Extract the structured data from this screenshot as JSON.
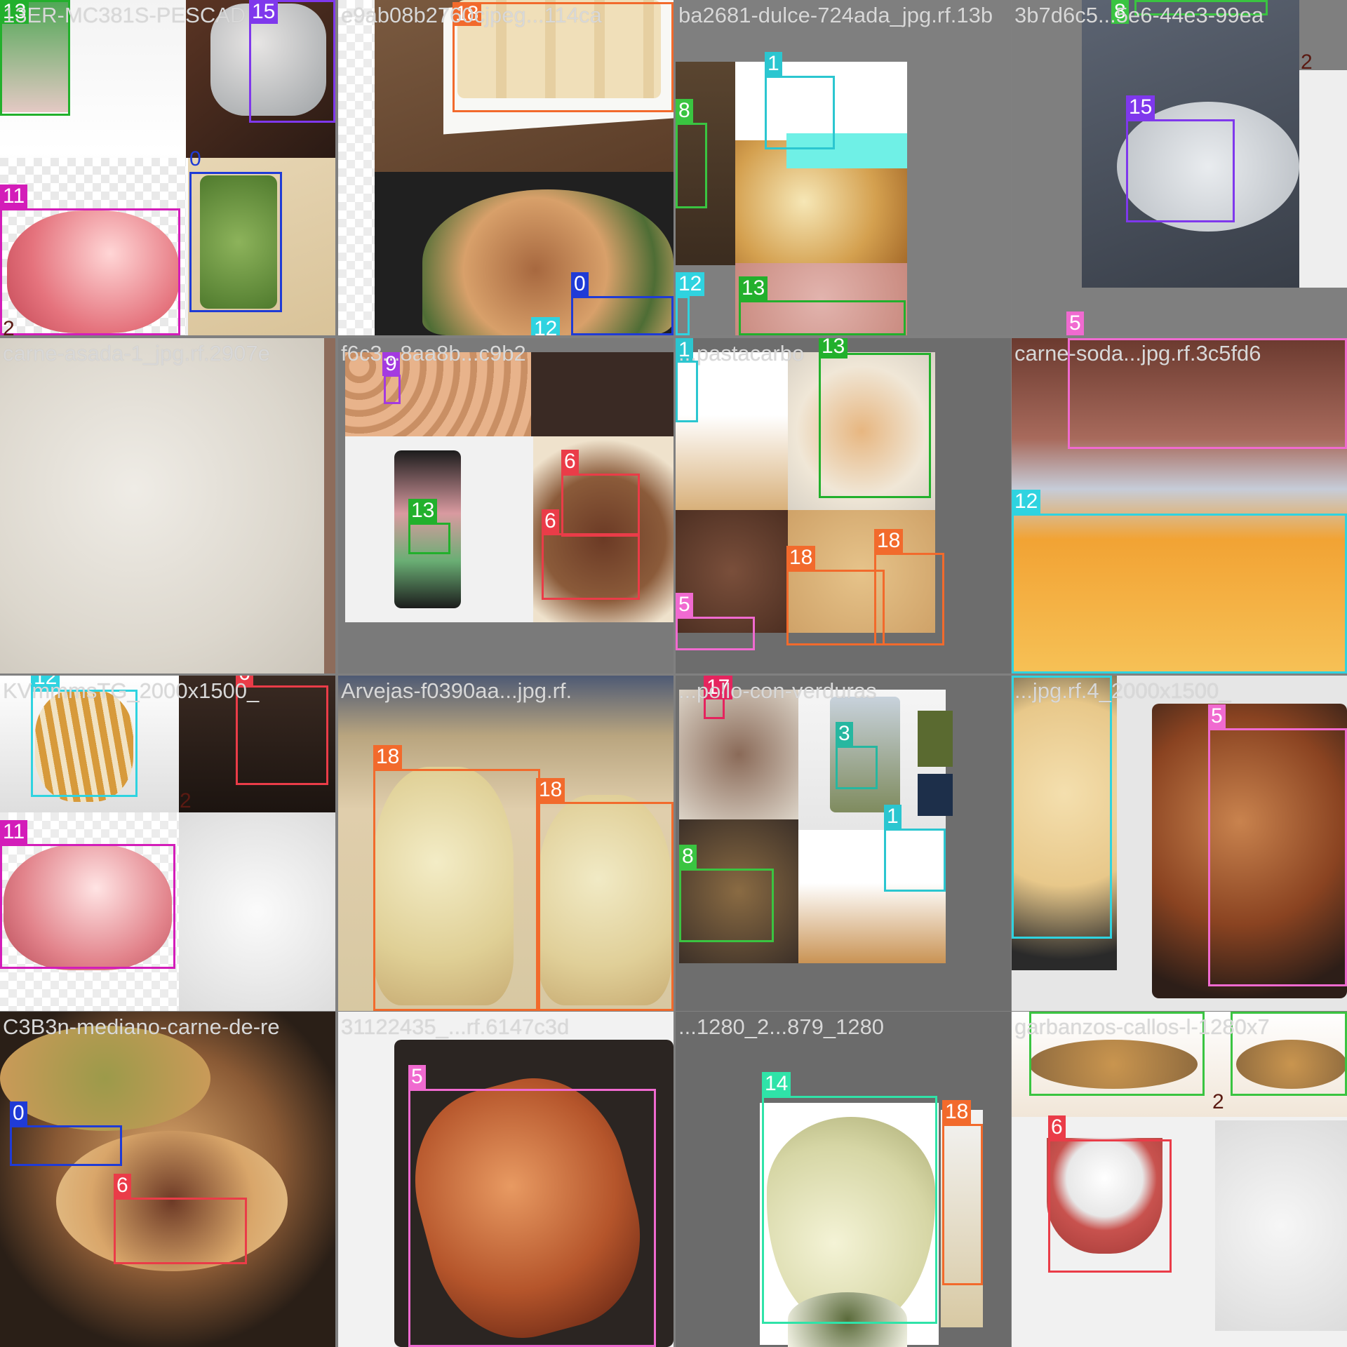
{
  "mosaic": {
    "tiles": [
      {
        "filename": "13ER-MC381S-PESCAD",
        "bg": "#eeeeee"
      },
      {
        "filename": "e9ab08b2760cjpeg...114ca",
        "bg": "#6e4e36"
      },
      {
        "filename": "ba2681-dulce-724ada_jpg.rf.13b",
        "bg": "#7f7f7f"
      },
      {
        "filename": "3b7d6c5...5e6-44e3-99ea",
        "bg": "#7f7f7f"
      },
      {
        "filename": "carne-asada-1_jpg.rf.2907e",
        "bg": "#e2ded6"
      },
      {
        "filename": "f6c3...8aa8b...c9b2",
        "bg": "#7a7a7a"
      },
      {
        "filename": "...pastacarbo",
        "bg": "#6d6d6d"
      },
      {
        "filename": "carne-soda...jpg.rf.3c5fd6",
        "bg": "#3a2a22"
      },
      {
        "filename": "KVmmmsTG_2000x1500_",
        "bg": "#f4f4f4"
      },
      {
        "filename": "Arvejas-f0390aa...jpg.rf.",
        "bg": "#cfc2a4"
      },
      {
        "filename": "...pollo-con-verduras",
        "bg": "#6e6e6e"
      },
      {
        "filename": "...jpg.rf.4_2000x1500_",
        "bg": "#e6e6e6"
      },
      {
        "filename": "C3B3n-mediano-carne-de-re",
        "bg": "#2a1f17"
      },
      {
        "filename": "31122435_...rf.6147c3d",
        "bg": "#f2f2f2"
      },
      {
        "filename": "...1280_2...879_1280",
        "bg": "#6b6b6b"
      },
      {
        "filename": "garbanzos-callos-l-1280x7",
        "bg": "#f1f1f1"
      }
    ],
    "boxes": [
      {
        "tile": 0,
        "label": "13",
        "color": "#22b02c"
      },
      {
        "tile": 0,
        "label": "15",
        "color": "#7f38ec"
      },
      {
        "tile": 0,
        "label": "0",
        "color": "#1f3bd6"
      },
      {
        "tile": 0,
        "label": "11",
        "color": "#d31db9"
      },
      {
        "tile": 0,
        "label": "2",
        "color": "#5a1a12"
      },
      {
        "tile": 1,
        "label": "18",
        "color": "#f26a2c"
      },
      {
        "tile": 1,
        "label": "0",
        "color": "#1f3bd6"
      },
      {
        "tile": 1,
        "label": "12",
        "color": "#2fd3e0"
      },
      {
        "tile": 2,
        "label": "1",
        "color": "#2bc6d0"
      },
      {
        "tile": 2,
        "label": "8",
        "color": "#3ac441"
      },
      {
        "tile": 2,
        "label": "12",
        "color": "#2fd3e0"
      },
      {
        "tile": 2,
        "label": "13",
        "color": "#22b02c"
      },
      {
        "tile": 3,
        "label": "8",
        "color": "#3ac441"
      },
      {
        "tile": 3,
        "label": "15",
        "color": "#7f38ec"
      },
      {
        "tile": 3,
        "label": "2",
        "color": "#5a1a12"
      },
      {
        "tile": 3,
        "label": "5",
        "color": "#f06ad0"
      },
      {
        "tile": 5,
        "label": "9",
        "color": "#a43ae0"
      },
      {
        "tile": 5,
        "label": "13",
        "color": "#22b02c"
      },
      {
        "tile": 5,
        "label": "6",
        "color": "#ea3c48"
      },
      {
        "tile": 5,
        "label": "6",
        "color": "#ea3c48"
      },
      {
        "tile": 6,
        "label": "1",
        "color": "#2bc6d0"
      },
      {
        "tile": 6,
        "label": "13",
        "color": "#22b02c"
      },
      {
        "tile": 6,
        "label": "18",
        "color": "#f26a2c"
      },
      {
        "tile": 6,
        "label": "18",
        "color": "#f26a2c"
      },
      {
        "tile": 6,
        "label": "5",
        "color": "#f06ad0"
      },
      {
        "tile": 7,
        "label": "12",
        "color": "#2fd3e0"
      },
      {
        "tile": 8,
        "label": "12",
        "color": "#2fd3e0"
      },
      {
        "tile": 8,
        "label": "6",
        "color": "#ea3c48"
      },
      {
        "tile": 8,
        "label": "2",
        "color": "#5a1a12"
      },
      {
        "tile": 8,
        "label": "11",
        "color": "#d31db9"
      },
      {
        "tile": 9,
        "label": "18",
        "color": "#f26a2c"
      },
      {
        "tile": 9,
        "label": "18",
        "color": "#f26a2c"
      },
      {
        "tile": 10,
        "label": "17",
        "color": "#e5245e"
      },
      {
        "tile": 10,
        "label": "3",
        "color": "#26b7a0"
      },
      {
        "tile": 10,
        "label": "1",
        "color": "#2bc6d0"
      },
      {
        "tile": 10,
        "label": "8",
        "color": "#3ac441"
      },
      {
        "tile": 11,
        "label": "12",
        "color": "#2fd3e0"
      },
      {
        "tile": 11,
        "label": "5",
        "color": "#f06ad0"
      },
      {
        "tile": 12,
        "label": "0",
        "color": "#1f3bd6"
      },
      {
        "tile": 12,
        "label": "6",
        "color": "#ea3c48"
      },
      {
        "tile": 13,
        "label": "5",
        "color": "#f06ad0"
      },
      {
        "tile": 14,
        "label": "14",
        "color": "#2fe3a8"
      },
      {
        "tile": 14,
        "label": "18",
        "color": "#f26a2c"
      },
      {
        "tile": 15,
        "label": "8",
        "color": "#3ac441"
      },
      {
        "tile": 15,
        "label": "8",
        "color": "#3ac441"
      },
      {
        "tile": 15,
        "label": "6",
        "color": "#ea3c48"
      },
      {
        "tile": 15,
        "label": "2",
        "color": "#5a1a12"
      }
    ]
  }
}
